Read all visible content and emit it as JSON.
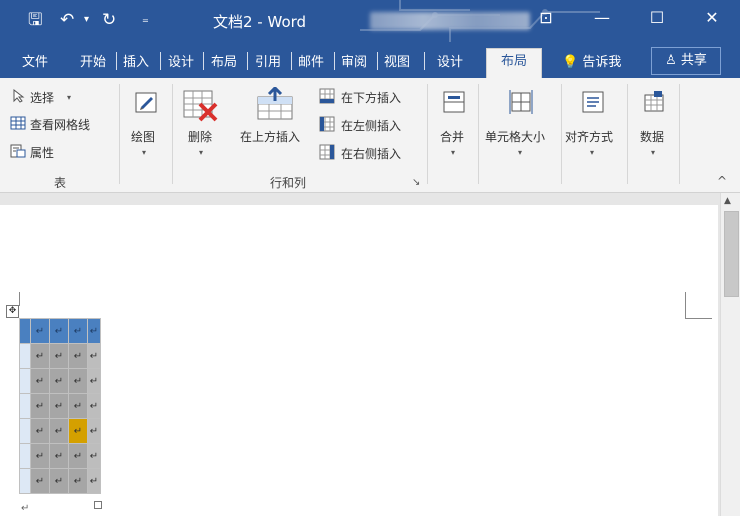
{
  "titlebar": {
    "doc_title": "文档2 - Word",
    "qa_save": "🖫",
    "qa_undo": "↶",
    "qa_dropdown": "▾",
    "qa_redo": "↻",
    "qa_customize": "₌",
    "ribbon_display": "⊡",
    "minimize": "—",
    "maximize": "☐",
    "close": "✕"
  },
  "tabs": [
    {
      "label": "文件"
    },
    {
      "label": "开始"
    },
    {
      "label": "插入"
    },
    {
      "label": "设计"
    },
    {
      "label": "布局"
    },
    {
      "label": "引用"
    },
    {
      "label": "邮件"
    },
    {
      "label": "审阅"
    },
    {
      "label": "视图"
    },
    {
      "label": "设计"
    },
    {
      "label": "布局",
      "active": true
    }
  ],
  "tellme": "💡 告诉我",
  "share": "♙ 共享",
  "ribbon": {
    "table_group": {
      "label": "表",
      "select": "选择",
      "select_arrow": "▾",
      "gridlines": "查看网格线",
      "properties": "属性"
    },
    "draw": {
      "label": "绘图",
      "arrow": "▾"
    },
    "delete": {
      "label": "删除",
      "arrow": "▾"
    },
    "insert_above": "在上方插入",
    "insert_below": "在下方插入",
    "insert_left": "在左侧插入",
    "insert_right": "在右侧插入",
    "rows_cols_label": "行和列",
    "merge": {
      "label": "合并",
      "arrow": "▾"
    },
    "cell_size": {
      "label": "单元格大小",
      "arrow": "▾"
    },
    "alignment": {
      "label": "对齐方式",
      "arrow": "▾"
    },
    "data": {
      "label": "数据",
      "arrow": "▾"
    },
    "dialog_launcher": "↘",
    "collapse": "^"
  },
  "document": {
    "para_mark": "↵",
    "cell_mark": "↵",
    "move_handle": "✥",
    "scroll_up": "▲",
    "rows": 7,
    "cols": 5,
    "highlight_cell": [
      4,
      3
    ],
    "colors": {
      "title_blue": "#2b579a",
      "header_row": "#4a80c0",
      "cell_gray": "#a6a6a6",
      "highlight": "#d4a000"
    }
  }
}
